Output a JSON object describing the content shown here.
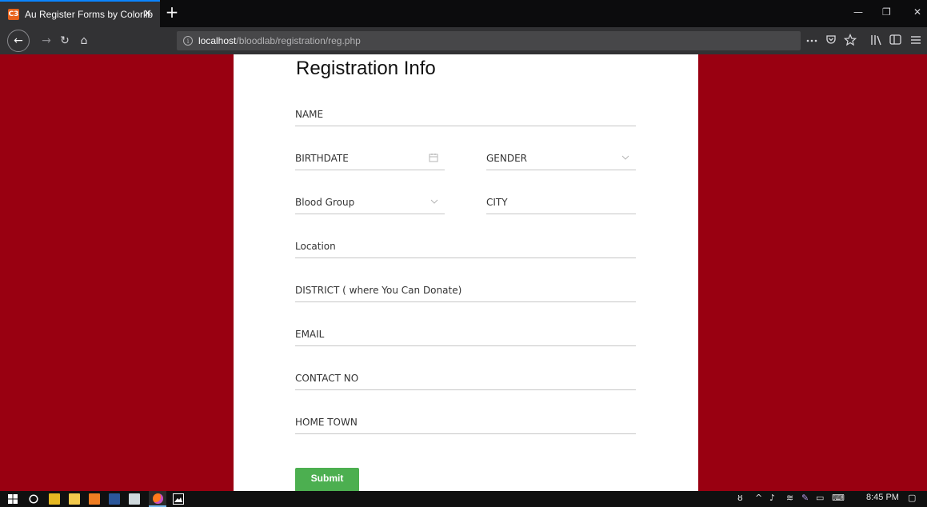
{
  "browser": {
    "tab_title": "Au Register Forms by Colorlib",
    "tab_close": "✕",
    "new_tab": "+",
    "favicon_text": "C3",
    "url_host": "localhost",
    "url_path": "/bloodlab/registration/reg.php",
    "window_controls": {
      "minimize": "—",
      "restore": "❐",
      "close": "✕"
    },
    "nav": {
      "back": "←",
      "forward": "→",
      "reload": "↻",
      "home": "⌂"
    },
    "toolbar_icons": [
      "more-icon",
      "pocket-icon",
      "bookmark-star-icon",
      "library-icon",
      "sidebar-icon",
      "menu-icon"
    ]
  },
  "colors": {
    "page_background": "#990011",
    "card_background": "#ffffff",
    "submit_button": "#4caf50",
    "accent": "#0a84ff"
  },
  "form": {
    "title": "Registration Info",
    "fields": {
      "name": "NAME",
      "birthdate": "BIRTHDATE",
      "gender": "GENDER",
      "blood_group": "Blood Group",
      "city": "CITY",
      "location": "Location",
      "district": "DISTRICT ( where You Can Donate)",
      "email": "EMAIL",
      "contact": "CONTACT NO",
      "home_town": "HOME TOWN"
    },
    "submit_label": "Submit"
  },
  "taskbar": {
    "time": "8:45 PM"
  }
}
